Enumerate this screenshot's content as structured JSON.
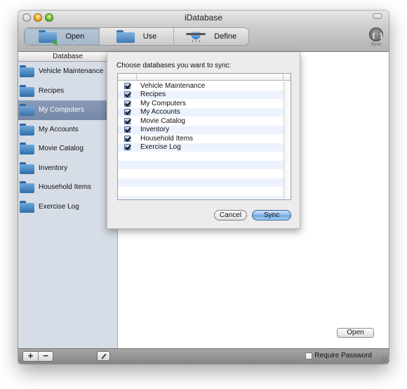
{
  "window": {
    "title": "iDatabase"
  },
  "toolbar": {
    "segments": [
      {
        "label": "Open",
        "icon": "folder-open-icon",
        "active": true
      },
      {
        "label": "Use",
        "icon": "folder-icon",
        "active": false
      },
      {
        "label": "Define",
        "icon": "funnel-icon",
        "active": false
      }
    ],
    "sync": {
      "label": "Sync",
      "icon": "sync-icon"
    }
  },
  "sidebar": {
    "header": "Database",
    "items": [
      {
        "label": "Vehicle Maintenance",
        "selected": false
      },
      {
        "label": "Recipes",
        "selected": false
      },
      {
        "label": "My Computers",
        "selected": true
      },
      {
        "label": "My Accounts",
        "selected": false
      },
      {
        "label": "Movie Catalog",
        "selected": false
      },
      {
        "label": "Inventory",
        "selected": false
      },
      {
        "label": "Household Items",
        "selected": false
      },
      {
        "label": "Exercise Log",
        "selected": false
      }
    ]
  },
  "content": {
    "open_button": "Open"
  },
  "bottombar": {
    "add_label": "+",
    "remove_label": "−",
    "require_password_label": "Require Password",
    "require_password_checked": false
  },
  "sync_sheet": {
    "prompt": "Choose databases you want to sync:",
    "rows": [
      {
        "label": "Vehicle Maintenance",
        "checked": true
      },
      {
        "label": "Recipes",
        "checked": true
      },
      {
        "label": "My Computers",
        "checked": true
      },
      {
        "label": "My Accounts",
        "checked": true
      },
      {
        "label": "Movie Catalog",
        "checked": true
      },
      {
        "label": "Inventory",
        "checked": true
      },
      {
        "label": "Household Items",
        "checked": true
      },
      {
        "label": "Exercise Log",
        "checked": true
      }
    ],
    "cancel_label": "Cancel",
    "sync_label": "Sync"
  }
}
